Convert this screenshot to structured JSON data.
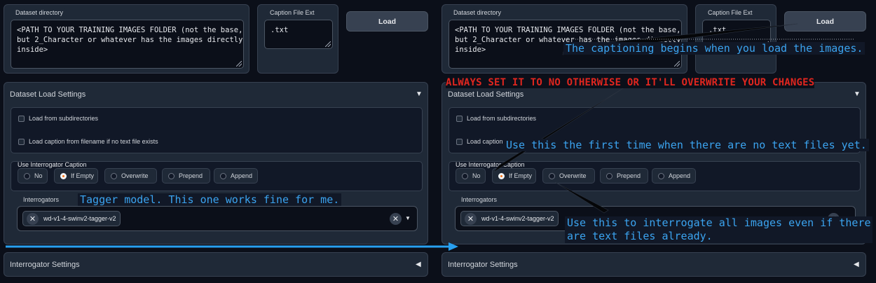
{
  "dataset": {
    "dir_label": "Dataset directory",
    "dir_value": "<PATH TO YOUR TRAINING IMAGES FOLDER (not the base,\nbut 2_Character or whatever has the images directly\ninside>",
    "ext_label": "Caption File Ext",
    "ext_value": ".txt",
    "load_label": "Load"
  },
  "load_settings": {
    "title": "Dataset Load Settings",
    "subdirs_label": "Load from subdirectories",
    "caption_label": "Load caption from filename if no text file exists"
  },
  "interrogator_caption": {
    "label": "Use Interrogator Caption",
    "options": [
      "No",
      "If Empty",
      "Overwrite",
      "Prepend",
      "Append"
    ],
    "selected": "If Empty"
  },
  "interrogators": {
    "label": "Interrogators",
    "chip": "wd-v1-4-swinv2-tagger-v2"
  },
  "interrogator_settings": {
    "title": "Interrogator Settings"
  },
  "annotations": {
    "tagger": "Tagger model. This one works fine for me.",
    "load": "The captioning begins when you load the images.",
    "always": "ALWAYS SET IT TO NO OTHERWISE OR IT'LL OVERWRITE YOUR CHANGES",
    "first_time": "Use this the first time when there are no text files yet.",
    "overwrite_line1": "Use this to interrogate all images even if there",
    "overwrite_line2": "are text files already."
  },
  "colors": {
    "background": "#0b0f19",
    "panel": "#1f2937",
    "annotation_blue": "#3ba4f0",
    "annotation_red": "#e0261f",
    "radio_selected": "#f97316"
  }
}
